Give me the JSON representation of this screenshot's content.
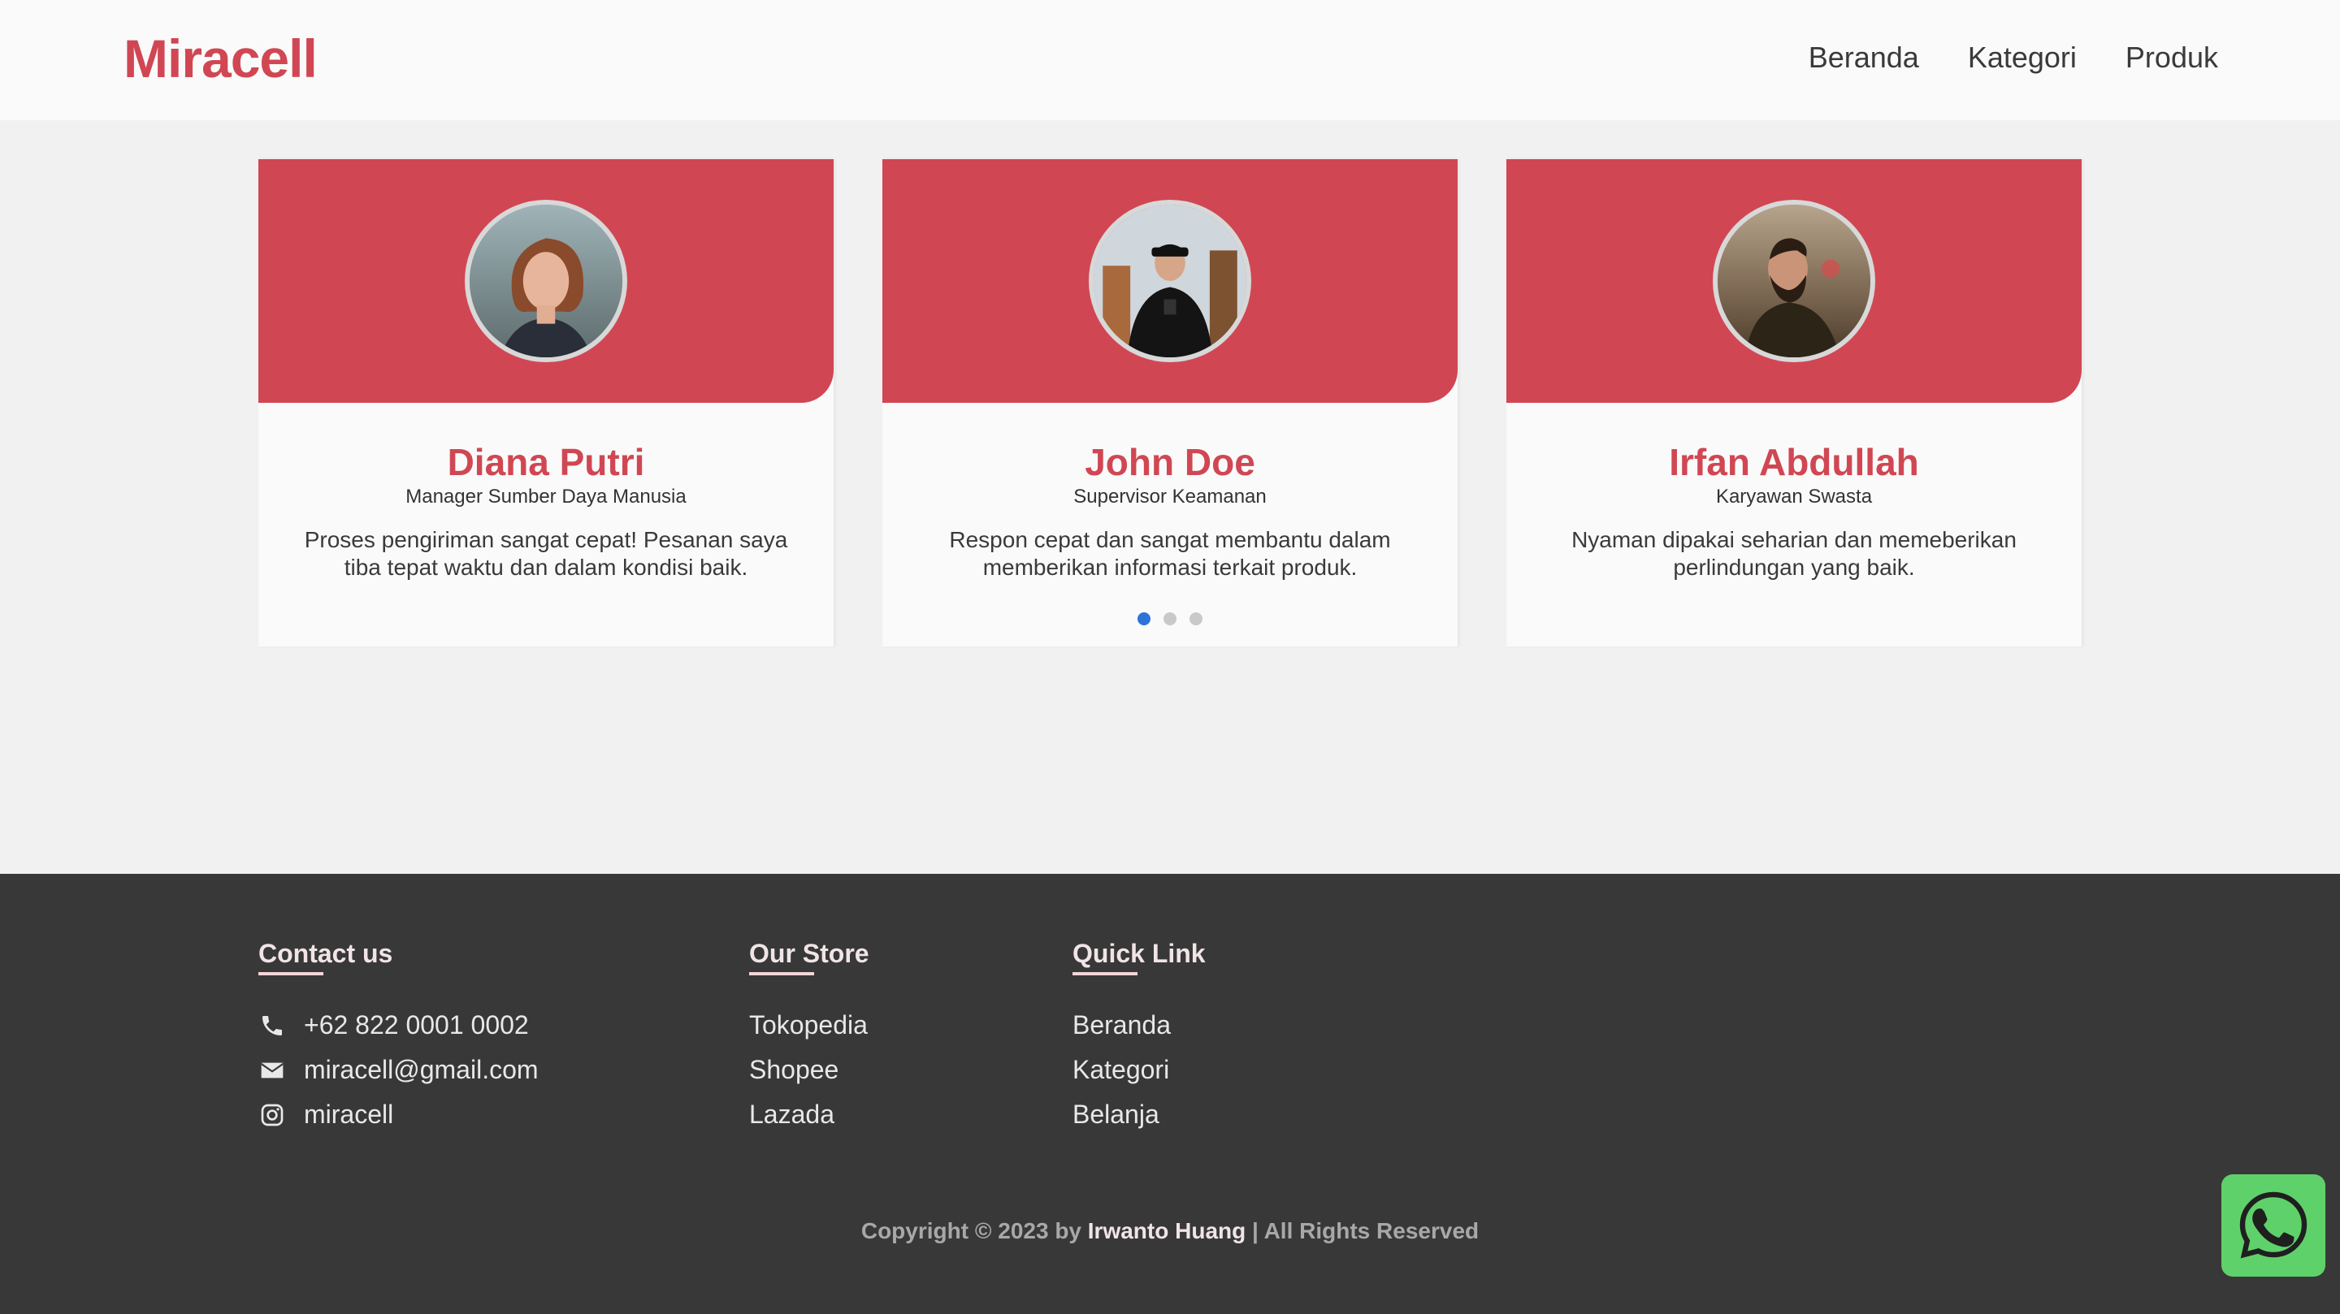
{
  "brand": {
    "name": "Miracell",
    "color": "#d04753"
  },
  "nav": {
    "items": [
      {
        "label": "Beranda"
      },
      {
        "label": "Kategori"
      },
      {
        "label": "Produk"
      }
    ]
  },
  "testimonials": [
    {
      "name": "Diana Putri",
      "role": "Manager Sumber Daya Manusia",
      "quote": "Proses pengiriman sangat cepat! Pesanan saya tiba tepat waktu dan dalam kondisi baik.",
      "avatar": "woman-portrait"
    },
    {
      "name": "John Doe",
      "role": "Supervisor Keamanan",
      "quote": "Respon cepat dan sangat membantu dalam memberikan informasi terkait produk.",
      "avatar": "man-cap-portrait"
    },
    {
      "name": "Irfan Abdullah",
      "role": "Karyawan Swasta",
      "quote": "Nyaman dipakai seharian dan memeberikan perlindungan yang baik.",
      "avatar": "bearded-man-portrait"
    }
  ],
  "carousel": {
    "active_index": 0,
    "count": 3,
    "active_color": "#2f73d9"
  },
  "footer": {
    "contact": {
      "title": "Contact us",
      "items": [
        {
          "icon": "phone-icon",
          "text": "+62 822 0001 0002"
        },
        {
          "icon": "envelope-icon",
          "text": "miracell@gmail.com"
        },
        {
          "icon": "instagram-icon",
          "text": "miracell"
        }
      ]
    },
    "store": {
      "title": "Our Store",
      "items": [
        "Tokopedia",
        "Shopee",
        "Lazada"
      ]
    },
    "quick_link": {
      "title": "Quick Link",
      "items": [
        "Beranda",
        "Kategori",
        "Belanja"
      ]
    },
    "copyright": {
      "prefix": "Copyright © 2023 by",
      "author": "Irwanto Huang",
      "suffix": "| All Rights Reserved"
    }
  },
  "whatsapp": {
    "icon": "whatsapp-icon",
    "color": "#5fd16a"
  }
}
